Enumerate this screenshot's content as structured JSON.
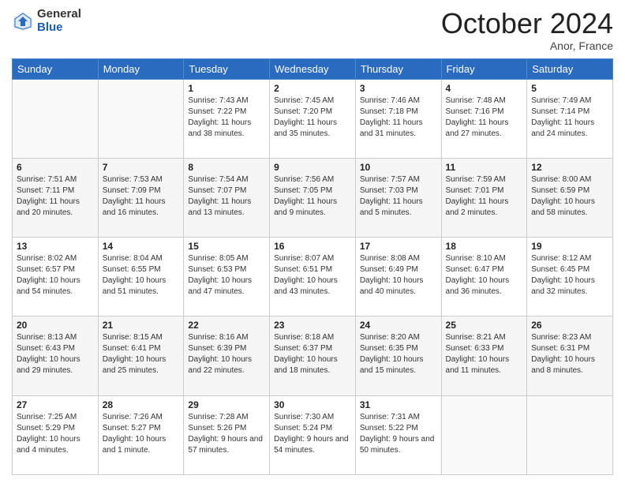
{
  "header": {
    "logo": {
      "general": "General",
      "blue": "Blue"
    },
    "title": "October 2024",
    "location": "Anor, France"
  },
  "weekdays": [
    "Sunday",
    "Monday",
    "Tuesday",
    "Wednesday",
    "Thursday",
    "Friday",
    "Saturday"
  ],
  "weeks": [
    [
      {
        "day": null
      },
      {
        "day": null
      },
      {
        "day": "1",
        "sunrise": "Sunrise: 7:43 AM",
        "sunset": "Sunset: 7:22 PM",
        "daylight": "Daylight: 11 hours and 38 minutes."
      },
      {
        "day": "2",
        "sunrise": "Sunrise: 7:45 AM",
        "sunset": "Sunset: 7:20 PM",
        "daylight": "Daylight: 11 hours and 35 minutes."
      },
      {
        "day": "3",
        "sunrise": "Sunrise: 7:46 AM",
        "sunset": "Sunset: 7:18 PM",
        "daylight": "Daylight: 11 hours and 31 minutes."
      },
      {
        "day": "4",
        "sunrise": "Sunrise: 7:48 AM",
        "sunset": "Sunset: 7:16 PM",
        "daylight": "Daylight: 11 hours and 27 minutes."
      },
      {
        "day": "5",
        "sunrise": "Sunrise: 7:49 AM",
        "sunset": "Sunset: 7:14 PM",
        "daylight": "Daylight: 11 hours and 24 minutes."
      }
    ],
    [
      {
        "day": "6",
        "sunrise": "Sunrise: 7:51 AM",
        "sunset": "Sunset: 7:11 PM",
        "daylight": "Daylight: 11 hours and 20 minutes."
      },
      {
        "day": "7",
        "sunrise": "Sunrise: 7:53 AM",
        "sunset": "Sunset: 7:09 PM",
        "daylight": "Daylight: 11 hours and 16 minutes."
      },
      {
        "day": "8",
        "sunrise": "Sunrise: 7:54 AM",
        "sunset": "Sunset: 7:07 PM",
        "daylight": "Daylight: 11 hours and 13 minutes."
      },
      {
        "day": "9",
        "sunrise": "Sunrise: 7:56 AM",
        "sunset": "Sunset: 7:05 PM",
        "daylight": "Daylight: 11 hours and 9 minutes."
      },
      {
        "day": "10",
        "sunrise": "Sunrise: 7:57 AM",
        "sunset": "Sunset: 7:03 PM",
        "daylight": "Daylight: 11 hours and 5 minutes."
      },
      {
        "day": "11",
        "sunrise": "Sunrise: 7:59 AM",
        "sunset": "Sunset: 7:01 PM",
        "daylight": "Daylight: 11 hours and 2 minutes."
      },
      {
        "day": "12",
        "sunrise": "Sunrise: 8:00 AM",
        "sunset": "Sunset: 6:59 PM",
        "daylight": "Daylight: 10 hours and 58 minutes."
      }
    ],
    [
      {
        "day": "13",
        "sunrise": "Sunrise: 8:02 AM",
        "sunset": "Sunset: 6:57 PM",
        "daylight": "Daylight: 10 hours and 54 minutes."
      },
      {
        "day": "14",
        "sunrise": "Sunrise: 8:04 AM",
        "sunset": "Sunset: 6:55 PM",
        "daylight": "Daylight: 10 hours and 51 minutes."
      },
      {
        "day": "15",
        "sunrise": "Sunrise: 8:05 AM",
        "sunset": "Sunset: 6:53 PM",
        "daylight": "Daylight: 10 hours and 47 minutes."
      },
      {
        "day": "16",
        "sunrise": "Sunrise: 8:07 AM",
        "sunset": "Sunset: 6:51 PM",
        "daylight": "Daylight: 10 hours and 43 minutes."
      },
      {
        "day": "17",
        "sunrise": "Sunrise: 8:08 AM",
        "sunset": "Sunset: 6:49 PM",
        "daylight": "Daylight: 10 hours and 40 minutes."
      },
      {
        "day": "18",
        "sunrise": "Sunrise: 8:10 AM",
        "sunset": "Sunset: 6:47 PM",
        "daylight": "Daylight: 10 hours and 36 minutes."
      },
      {
        "day": "19",
        "sunrise": "Sunrise: 8:12 AM",
        "sunset": "Sunset: 6:45 PM",
        "daylight": "Daylight: 10 hours and 32 minutes."
      }
    ],
    [
      {
        "day": "20",
        "sunrise": "Sunrise: 8:13 AM",
        "sunset": "Sunset: 6:43 PM",
        "daylight": "Daylight: 10 hours and 29 minutes."
      },
      {
        "day": "21",
        "sunrise": "Sunrise: 8:15 AM",
        "sunset": "Sunset: 6:41 PM",
        "daylight": "Daylight: 10 hours and 25 minutes."
      },
      {
        "day": "22",
        "sunrise": "Sunrise: 8:16 AM",
        "sunset": "Sunset: 6:39 PM",
        "daylight": "Daylight: 10 hours and 22 minutes."
      },
      {
        "day": "23",
        "sunrise": "Sunrise: 8:18 AM",
        "sunset": "Sunset: 6:37 PM",
        "daylight": "Daylight: 10 hours and 18 minutes."
      },
      {
        "day": "24",
        "sunrise": "Sunrise: 8:20 AM",
        "sunset": "Sunset: 6:35 PM",
        "daylight": "Daylight: 10 hours and 15 minutes."
      },
      {
        "day": "25",
        "sunrise": "Sunrise: 8:21 AM",
        "sunset": "Sunset: 6:33 PM",
        "daylight": "Daylight: 10 hours and 11 minutes."
      },
      {
        "day": "26",
        "sunrise": "Sunrise: 8:23 AM",
        "sunset": "Sunset: 6:31 PM",
        "daylight": "Daylight: 10 hours and 8 minutes."
      }
    ],
    [
      {
        "day": "27",
        "sunrise": "Sunrise: 7:25 AM",
        "sunset": "Sunset: 5:29 PM",
        "daylight": "Daylight: 10 hours and 4 minutes."
      },
      {
        "day": "28",
        "sunrise": "Sunrise: 7:26 AM",
        "sunset": "Sunset: 5:27 PM",
        "daylight": "Daylight: 10 hours and 1 minute."
      },
      {
        "day": "29",
        "sunrise": "Sunrise: 7:28 AM",
        "sunset": "Sunset: 5:26 PM",
        "daylight": "Daylight: 9 hours and 57 minutes."
      },
      {
        "day": "30",
        "sunrise": "Sunrise: 7:30 AM",
        "sunset": "Sunset: 5:24 PM",
        "daylight": "Daylight: 9 hours and 54 minutes."
      },
      {
        "day": "31",
        "sunrise": "Sunrise: 7:31 AM",
        "sunset": "Sunset: 5:22 PM",
        "daylight": "Daylight: 9 hours and 50 minutes."
      },
      {
        "day": null
      },
      {
        "day": null
      }
    ]
  ]
}
